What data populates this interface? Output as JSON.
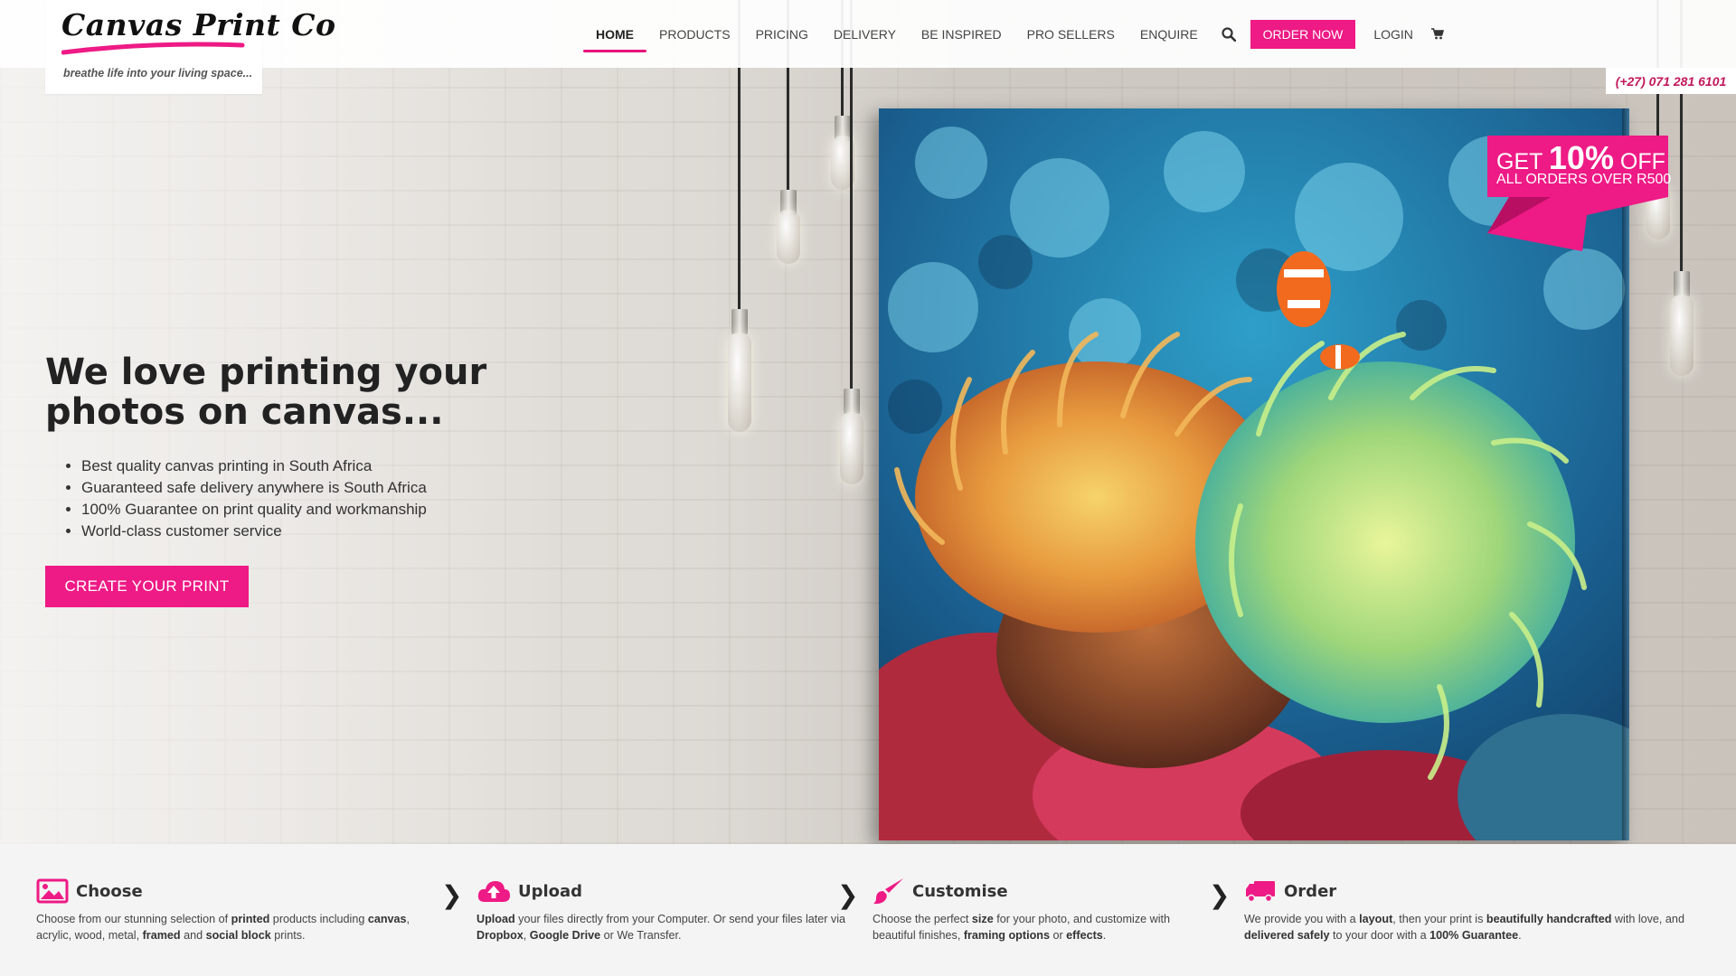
{
  "brand": {
    "name": "Canvas Print Co",
    "tagline": "breathe life into your living space...",
    "accent": "#ee1a85"
  },
  "nav": {
    "items": [
      {
        "label": "HOME",
        "active": true
      },
      {
        "label": "PRODUCTS"
      },
      {
        "label": "PRICING"
      },
      {
        "label": "DELIVERY"
      },
      {
        "label": "BE INSPIRED"
      },
      {
        "label": "PRO SELLERS"
      },
      {
        "label": "ENQUIRE"
      }
    ],
    "search_icon": "search-icon",
    "order_label": "ORDER NOW",
    "login_label": "LOGIN",
    "cart_icon": "cart-icon"
  },
  "phone": "(+27) 071 281 6101",
  "promo": {
    "prefix": "GET",
    "percent": "10%",
    "suffix": "OFF",
    "line2": "ALL ORDERS OVER R500"
  },
  "hero": {
    "headline": "We love printing your photos on canvas...",
    "bullets": [
      "Best quality canvas printing in South Africa",
      "Guaranteed safe delivery anywhere is South Africa",
      "100% Guarantee on print quality and workmanship",
      "World-class customer service"
    ],
    "cta_label": "CREATE YOUR PRINT"
  },
  "steps": [
    {
      "title": "Choose",
      "icon": "image-icon",
      "desc": [
        {
          "t": "Choose from our stunning selection of "
        },
        {
          "t": "printed",
          "b": true
        },
        {
          "t": " products including "
        },
        {
          "t": "canvas",
          "b": true
        },
        {
          "t": ", acrylic, wood, metal, "
        },
        {
          "t": "framed",
          "b": true
        },
        {
          "t": " and "
        },
        {
          "t": "social block",
          "b": true
        },
        {
          "t": " prints."
        }
      ]
    },
    {
      "title": "Upload",
      "icon": "cloud-upload-icon",
      "desc": [
        {
          "t": "Upload",
          "b": true
        },
        {
          "t": " your files directly from your Computer. Or send your files later via "
        },
        {
          "t": "Dropbox",
          "b": true
        },
        {
          "t": ", "
        },
        {
          "t": "Google Drive",
          "b": true
        },
        {
          "t": " or We Transfer."
        }
      ]
    },
    {
      "title": "Customise",
      "icon": "paintbrush-icon",
      "desc": [
        {
          "t": "Choose the perfect "
        },
        {
          "t": "size",
          "b": true
        },
        {
          "t": " for your photo, and customize with beautiful finishes, "
        },
        {
          "t": "framing options",
          "b": true
        },
        {
          "t": " or "
        },
        {
          "t": "effects",
          "b": true
        },
        {
          "t": "."
        }
      ]
    },
    {
      "title": "Order",
      "icon": "truck-icon",
      "desc": [
        {
          "t": "We provide you with a "
        },
        {
          "t": "layout",
          "b": true
        },
        {
          "t": ", then your print is "
        },
        {
          "t": "beautifully handcrafted",
          "b": true
        },
        {
          "t": " with love, and "
        },
        {
          "t": "delivered safely",
          "b": true
        },
        {
          "t": " to your door with a "
        },
        {
          "t": "100% Guarantee",
          "b": true
        },
        {
          "t": "."
        }
      ]
    }
  ],
  "step_separator": "❯"
}
